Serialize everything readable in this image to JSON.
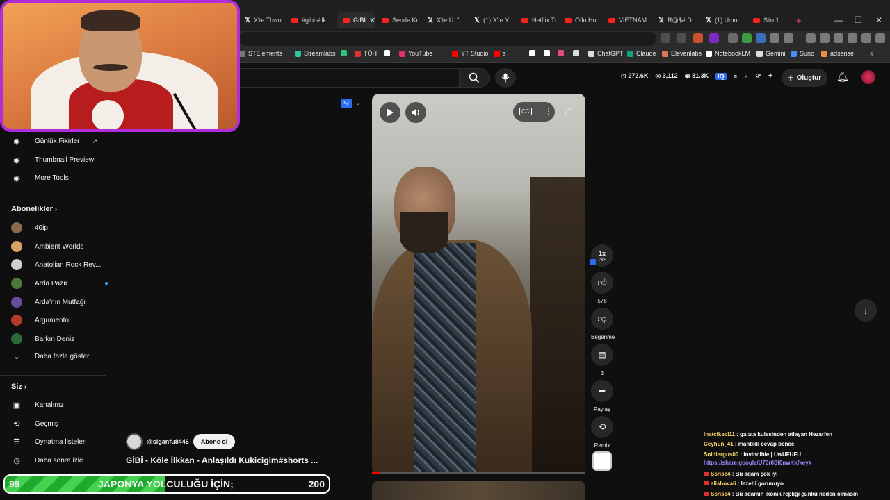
{
  "browser": {
    "tabs": [
      {
        "label": "X'te Thwo",
        "icon": "x"
      },
      {
        "label": "#gibi #ilk",
        "icon": "youtube"
      },
      {
        "label": "GİBİ",
        "icon": "youtube",
        "active": true
      },
      {
        "label": "Sende Kr",
        "icon": "youtube"
      },
      {
        "label": "X'te U: \"t",
        "icon": "x"
      },
      {
        "label": "(1) X'te Y",
        "icon": "x"
      },
      {
        "label": "Netflix Tı",
        "icon": "youtube"
      },
      {
        "label": "Oflu Hoc",
        "icon": "youtube"
      },
      {
        "label": "VİETNAM",
        "icon": "youtube"
      },
      {
        "label": "R@$# D",
        "icon": "x"
      },
      {
        "label": "(1) Umur",
        "icon": "x"
      },
      {
        "label": "Silo 1",
        "icon": "youtube"
      }
    ],
    "bookmarks": [
      "STElements",
      "Streamlabs",
      "",
      "TÖH",
      "",
      "YouTube",
      "YT Studio",
      "s",
      "",
      "",
      "",
      "",
      "ChatGPT",
      "Claude",
      "Elevenlabs",
      "NotebookLM",
      "Gemini",
      "Suno",
      "adsense"
    ]
  },
  "header": {
    "stats": {
      "views": "272.6K",
      "likes": "3,112",
      "subs": "81.3K"
    },
    "create_label": "Oluştur"
  },
  "sidebar": {
    "tools": [
      {
        "label": "Günlük Fikirler"
      },
      {
        "label": "Thumbnail Preview"
      },
      {
        "label": "More Tools"
      }
    ],
    "subs_heading": "Abonelikler",
    "subscriptions": [
      {
        "label": "40ip",
        "color": "#8a6a4a"
      },
      {
        "label": "Ambient Worlds",
        "color": "#d9a066"
      },
      {
        "label": "Anatolian Rock Rev...",
        "color": "#cfcfcf"
      },
      {
        "label": "Arda Pazır",
        "color": "#4d7a3a",
        "dot": true
      },
      {
        "label": "Arda'nın Mutfağı",
        "color": "#6a4a9a"
      },
      {
        "label": "Argumento",
        "color": "#b23b2b"
      },
      {
        "label": "Barkın Deniz",
        "color": "#2a6a3a"
      }
    ],
    "show_more": "Daha fazla göster",
    "you_heading": "Siz",
    "you_items": [
      {
        "label": "Kanalınız"
      },
      {
        "label": "Geçmiş"
      },
      {
        "label": "Oynatma listeleri"
      },
      {
        "label": "Daha sonra izle"
      }
    ]
  },
  "short": {
    "speed": "1x",
    "likes": "578",
    "dislike_label": "Beğenme",
    "comments": "2",
    "share_label": "Paylaş",
    "remix_label": "Remix",
    "progress": 0.04,
    "channel": "@siganfu8446",
    "subscribe_label": "Abone ol",
    "title": "GİBİ - Köle İlkkan - Anlaşıldı Kukicigim#shorts ..."
  },
  "overlay": {
    "goal": {
      "current": "99",
      "text": "JAPONYA YOLCULUĞU İÇİN;",
      "target": "200",
      "fraction": 0.495
    },
    "chat": [
      {
        "user": "inatcikeci11",
        "msg": "galata kulesinden atlayan Hezarfen"
      },
      {
        "user": "Ceyhun_41",
        "msg": "mantıklı cevap bence"
      },
      {
        "user": "Soldiergus00",
        "msg": "Invincible | UwUFUFU"
      },
      {
        "user": "",
        "msg": "https://share.google/U70r0Sf0nwKkfkeyk"
      },
      {
        "user": "Ssrise4",
        "msg": "Bu adam çok iyi"
      },
      {
        "user": "alishovali",
        "msg": "lezetli gorunuyo"
      },
      {
        "user": "Ssrise4",
        "msg": "Bu adamın ikonik repliği çünkü neden olmasın"
      }
    ]
  }
}
